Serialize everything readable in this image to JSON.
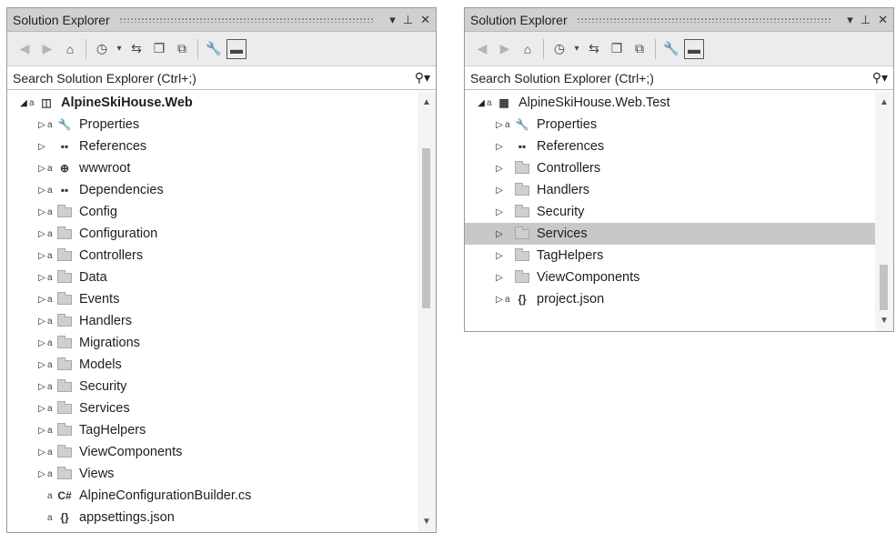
{
  "left": {
    "title": "Solution Explorer",
    "search_placeholder": "Search Solution Explorer (Ctrl+;)",
    "rows": [
      {
        "label": "AlpineSkiHouse.Web",
        "icon": "web-project-icon",
        "bold": true,
        "expanded": true
      },
      {
        "label": "Properties",
        "icon": "wrench-icon"
      },
      {
        "label": "References",
        "icon": "references-icon"
      },
      {
        "label": "wwwroot",
        "icon": "globe-folder-icon"
      },
      {
        "label": "Dependencies",
        "icon": "dependencies-icon"
      },
      {
        "label": "Config",
        "icon": "folder-icon"
      },
      {
        "label": "Configuration",
        "icon": "folder-icon"
      },
      {
        "label": "Controllers",
        "icon": "folder-icon"
      },
      {
        "label": "Data",
        "icon": "folder-icon"
      },
      {
        "label": "Events",
        "icon": "folder-icon"
      },
      {
        "label": "Handlers",
        "icon": "folder-icon"
      },
      {
        "label": "Migrations",
        "icon": "folder-icon"
      },
      {
        "label": "Models",
        "icon": "folder-icon"
      },
      {
        "label": "Security",
        "icon": "folder-icon"
      },
      {
        "label": "Services",
        "icon": "folder-icon"
      },
      {
        "label": "TagHelpers",
        "icon": "folder-icon"
      },
      {
        "label": "ViewComponents",
        "icon": "folder-icon"
      },
      {
        "label": "Views",
        "icon": "folder-icon"
      },
      {
        "label": "AlpineConfigurationBuilder.cs",
        "icon": "csharp-file-icon"
      },
      {
        "label": "appsettings.json",
        "icon": "json-file-icon"
      }
    ]
  },
  "right": {
    "title": "Solution Explorer",
    "search_placeholder": "Search Solution Explorer (Ctrl+;)",
    "rows": [
      {
        "label": "AlpineSkiHouse.Web.Test",
        "icon": "test-project-icon",
        "expanded": true
      },
      {
        "label": "Properties",
        "icon": "wrench-icon"
      },
      {
        "label": "References",
        "icon": "references-icon"
      },
      {
        "label": "Controllers",
        "icon": "folder-icon"
      },
      {
        "label": "Handlers",
        "icon": "folder-icon"
      },
      {
        "label": "Security",
        "icon": "folder-icon"
      },
      {
        "label": "Services",
        "icon": "folder-icon",
        "selected": true
      },
      {
        "label": "TagHelpers",
        "icon": "folder-icon"
      },
      {
        "label": "ViewComponents",
        "icon": "folder-icon"
      },
      {
        "label": "project.json",
        "icon": "json-file-icon"
      }
    ]
  },
  "colors": {
    "titlebar": "#d0d0d0",
    "selected_row": "#c8c8c8"
  }
}
